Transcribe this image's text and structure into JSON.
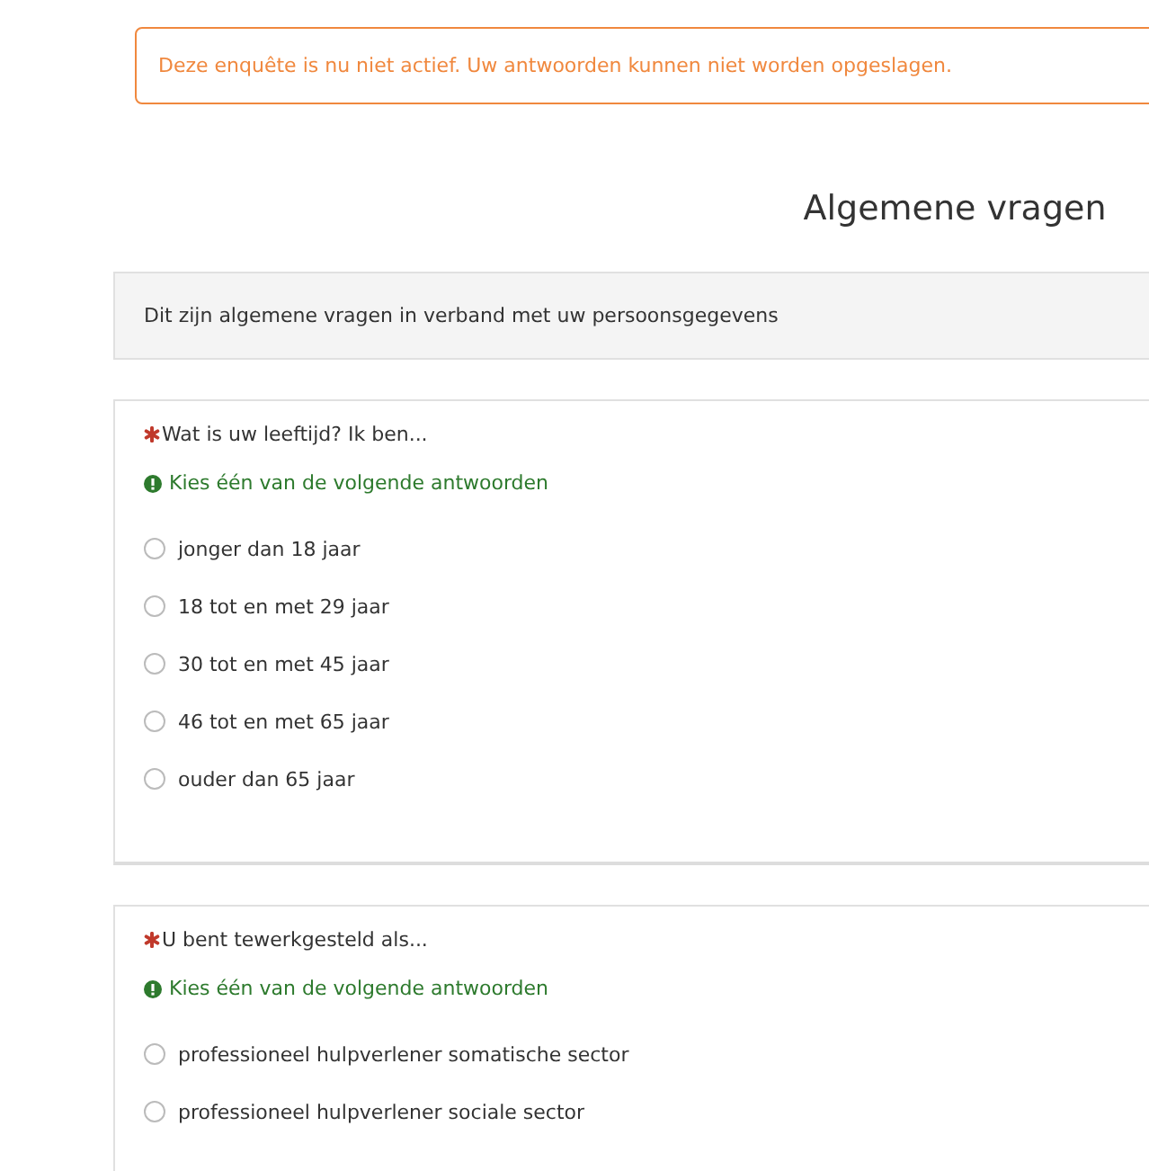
{
  "alert": {
    "text": "Deze enquête is nu niet actief. Uw antwoorden kunnen niet worden opgeslagen."
  },
  "group": {
    "title": "Algemene vragen",
    "description": "Dit zijn algemene vragen in verband met uw persoonsgegevens"
  },
  "questions": [
    {
      "required": true,
      "text": "Wat is uw leeftijd? Ik ben...",
      "hint": "Kies één van de volgende antwoorden",
      "options": [
        {
          "label": "jonger dan 18 jaar",
          "selected": false
        },
        {
          "label": "18 tot en met 29 jaar",
          "selected": false
        },
        {
          "label": "30 tot en met 45 jaar",
          "selected": false
        },
        {
          "label": "46 tot en met 65 jaar",
          "selected": false
        },
        {
          "label": "ouder dan 65 jaar",
          "selected": false
        }
      ]
    },
    {
      "required": true,
      "text": "U bent tewerkgesteld als...",
      "hint": "Kies één van de volgende antwoorden",
      "options": [
        {
          "label": "professioneel hulpverlener somatische sector",
          "selected": false
        },
        {
          "label": "professioneel hulpverlener sociale sector",
          "selected": false
        }
      ]
    }
  ]
}
